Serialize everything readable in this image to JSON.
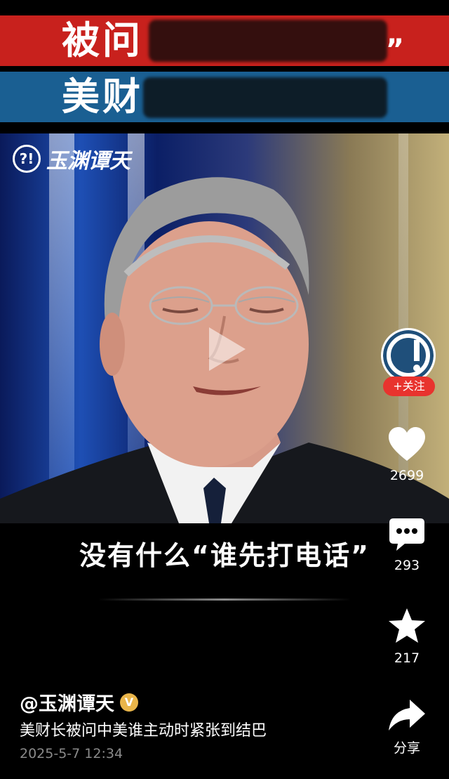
{
  "banner": {
    "line1": "被问",
    "line1_quote": "”",
    "line2": "美财"
  },
  "video": {
    "watermark": "玉渊谭天",
    "subtitle": "没有什么“谁先打电话”"
  },
  "actions": {
    "follow_label": "+关注",
    "likes": "2699",
    "comments": "293",
    "favorites": "217",
    "share_label": "分享"
  },
  "post": {
    "author": "@玉渊谭天",
    "verified_badge": "V",
    "description": "美财长被问中美谁主动时紧张到结巴",
    "date": "2025-5-7 12:34"
  },
  "colors": {
    "banner_red": "#c8211d",
    "banner_blue": "#1a5f92",
    "follow_red": "#e8332e"
  }
}
